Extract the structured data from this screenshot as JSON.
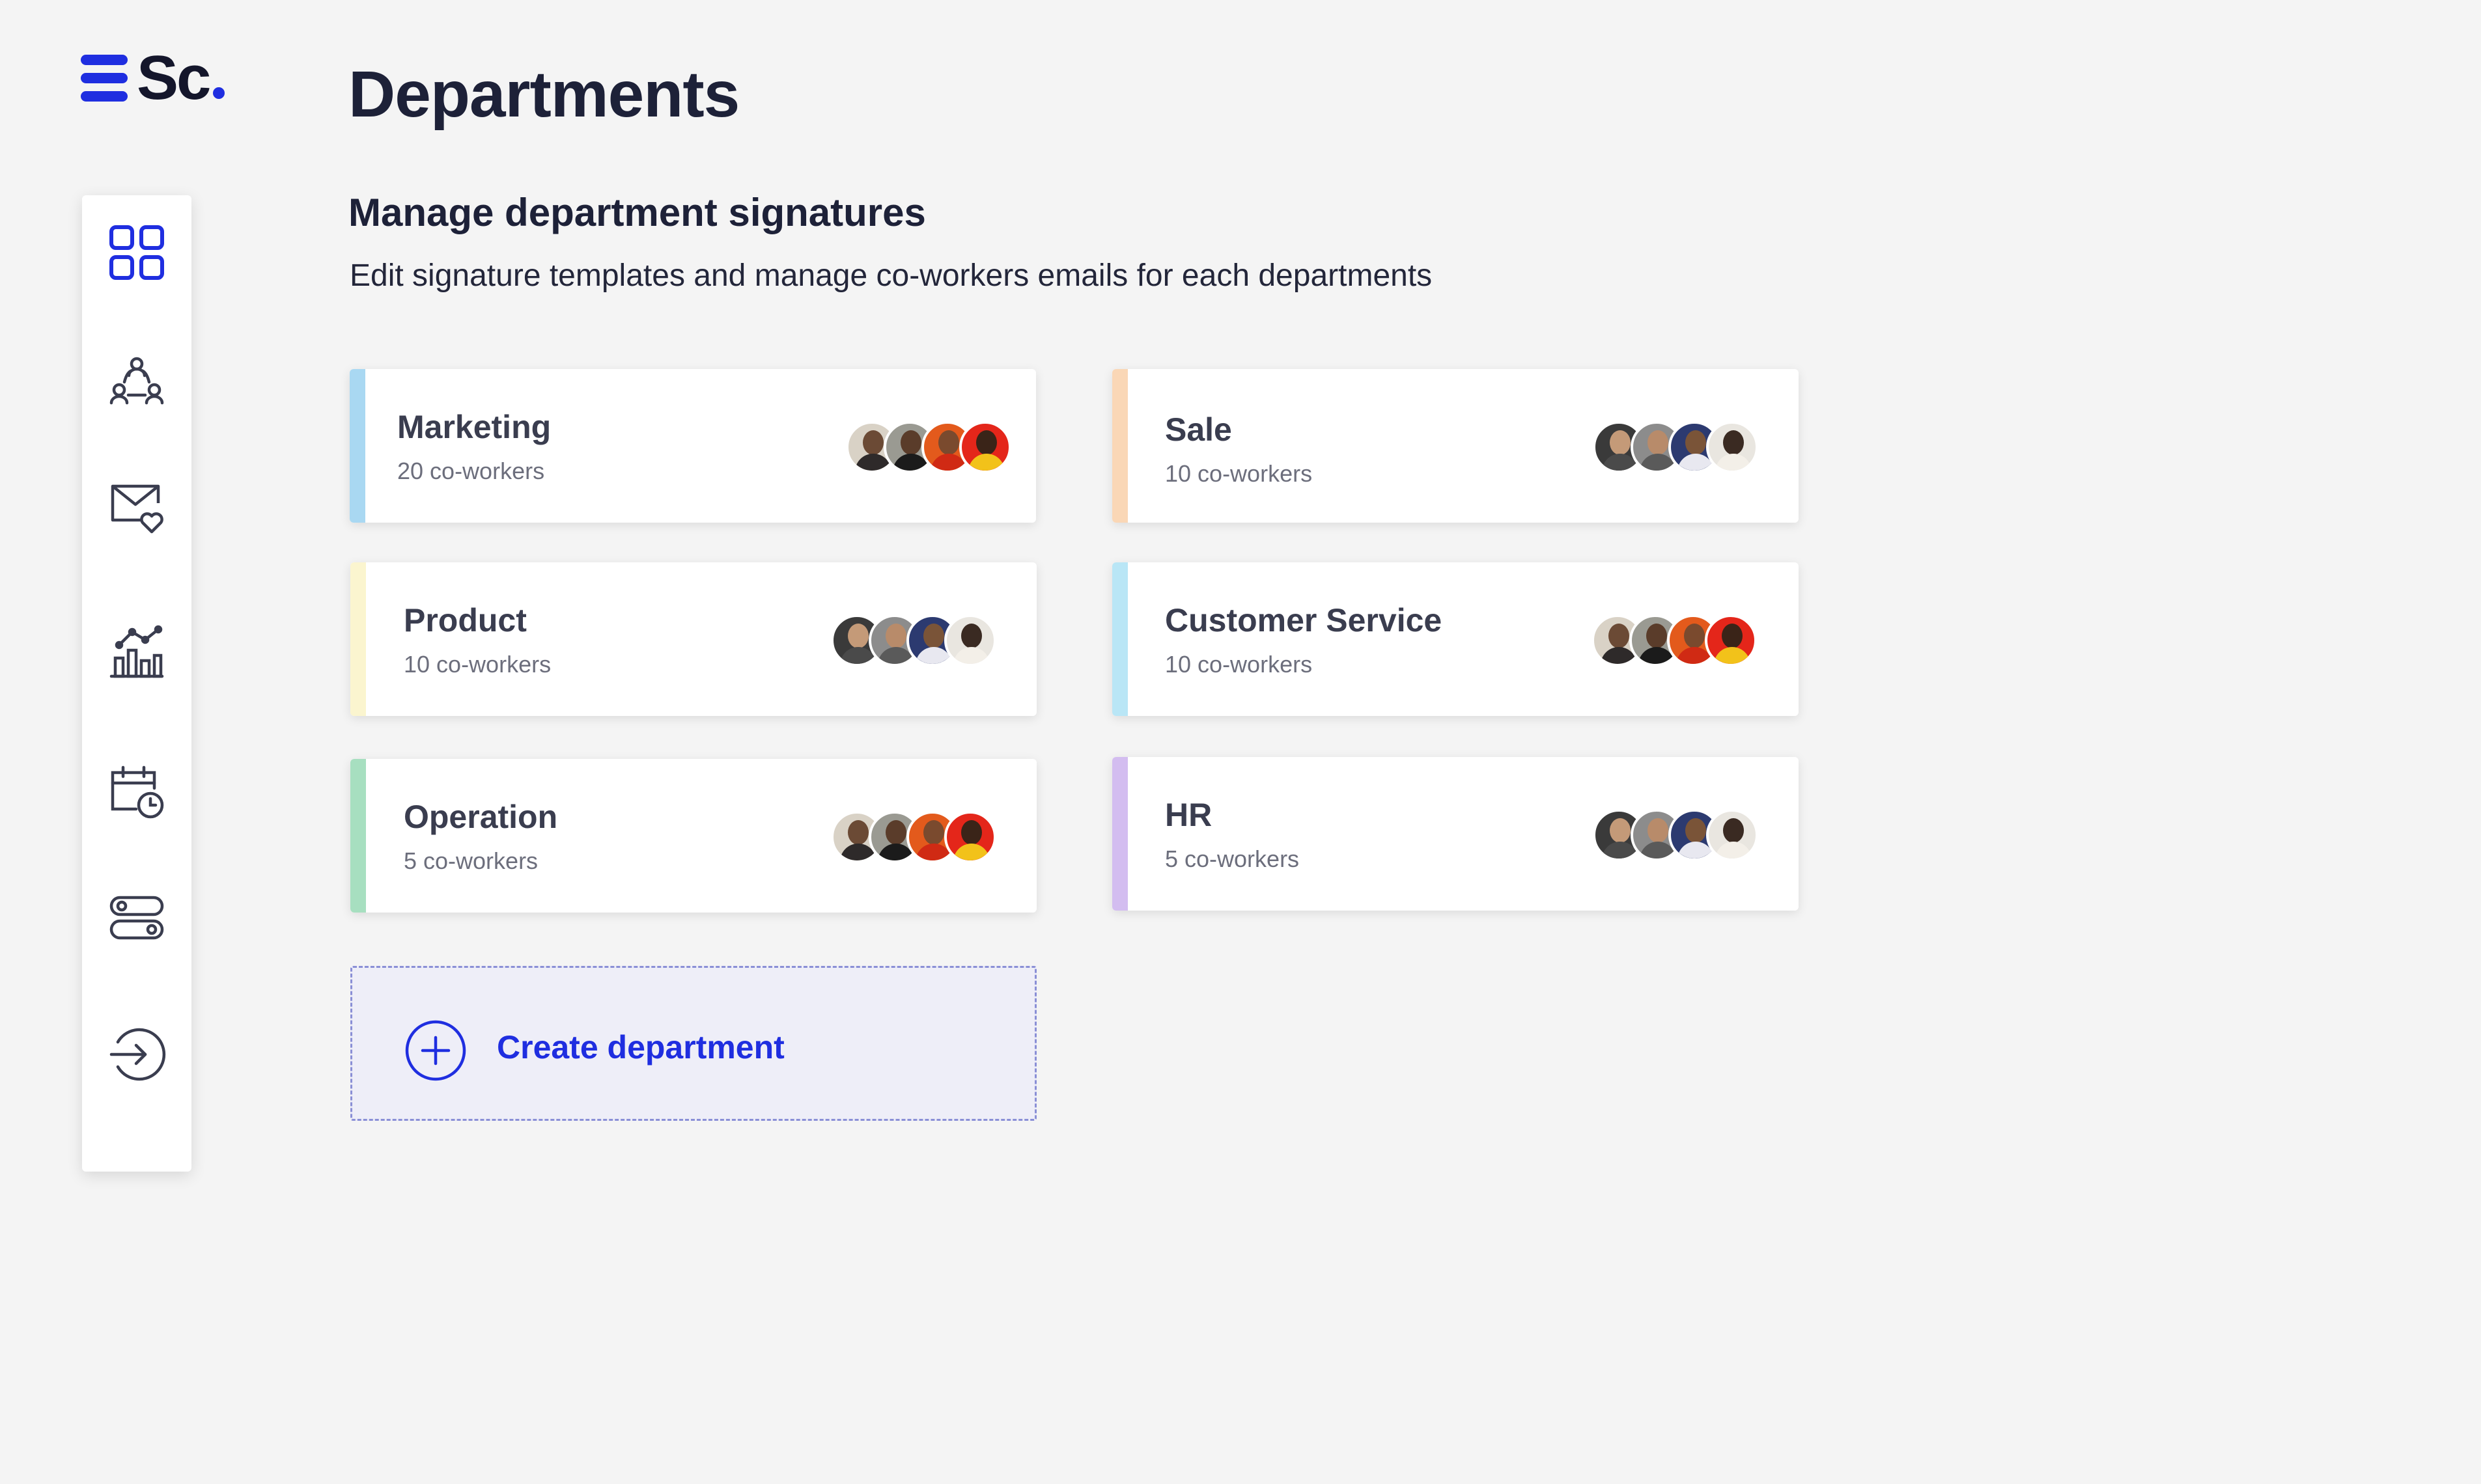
{
  "brand": {
    "name": "Sc",
    "accent": "#1f2ee0"
  },
  "page": {
    "title": "Departments",
    "section_title": "Manage department signatures",
    "section_subtitle": "Edit signature templates and manage co-workers emails for each departments"
  },
  "sidebar": {
    "items": [
      {
        "icon": "grid-dashboard-icon",
        "active": true
      },
      {
        "icon": "team-network-icon",
        "active": false
      },
      {
        "icon": "mail-heart-icon",
        "active": false
      },
      {
        "icon": "analytics-chart-icon",
        "active": false
      },
      {
        "icon": "calendar-clock-icon",
        "active": false
      },
      {
        "icon": "toggle-settings-icon",
        "active": false
      },
      {
        "icon": "logout-icon",
        "active": false
      }
    ]
  },
  "departments": [
    {
      "name": "Marketing",
      "count": "20 co-workers",
      "color": "#a9d8f2"
    },
    {
      "name": "Sale",
      "count": "10 co-workers",
      "color": "#fad7b6"
    },
    {
      "name": "Product",
      "count": "10 co-workers",
      "color": "#fbf5cf"
    },
    {
      "name": "Customer Service",
      "count": "10 co-workers",
      "color": "#b9e6f6"
    },
    {
      "name": "Operation",
      "count": "5 co-workers",
      "color": "#a7dfc0"
    },
    {
      "name": "HR",
      "count": "5 co-workers",
      "color": "#d3bdf0"
    }
  ],
  "create": {
    "label": "Create department"
  }
}
